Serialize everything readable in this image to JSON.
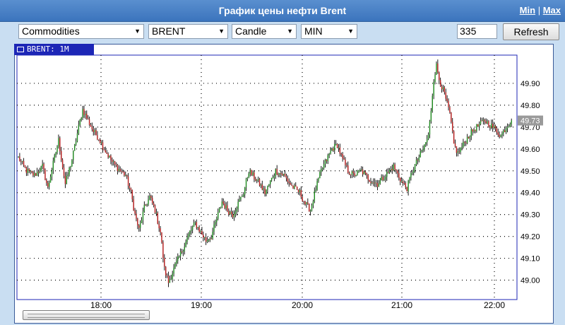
{
  "window": {
    "title": "График цены нефти Brent",
    "min_label": "Min",
    "separator": "|",
    "max_label": "Max"
  },
  "toolbar": {
    "category": "Commodities",
    "instrument": "BRENT",
    "chart_type": "Candle",
    "interval": "MIN",
    "bars": "335",
    "refresh_label": "Refresh"
  },
  "chart_tab_label": "BRENT: 1M",
  "colors": {
    "up": "#1e8a1e",
    "down": "#b51a1a",
    "wick": "#000000",
    "grid": "#000000",
    "frame": "#1c26b6",
    "price_badge": "#9a9a9a"
  },
  "chart_data": {
    "type": "candlestick",
    "symbol": "BRENT",
    "interval": "1M",
    "title": "",
    "xlabel": "",
    "ylabel": "",
    "ylim": [
      48.96,
      50.0
    ],
    "y_ticks": [
      "49.00",
      "49.10",
      "49.20",
      "49.30",
      "49.40",
      "49.50",
      "49.60",
      "49.70",
      "49.80",
      "49.90"
    ],
    "x_ticks": [
      "18:00",
      "19:00",
      "20:00",
      "21:00",
      "22:00"
    ],
    "last_price": "49.73",
    "grid": true,
    "anchors": [
      [
        0,
        49.56
      ],
      [
        6,
        49.5
      ],
      [
        12,
        49.48
      ],
      [
        18,
        49.52
      ],
      [
        22,
        49.42
      ],
      [
        24,
        49.48
      ],
      [
        30,
        49.64
      ],
      [
        35,
        49.44
      ],
      [
        40,
        49.55
      ],
      [
        45,
        49.7
      ],
      [
        48,
        49.78
      ],
      [
        52,
        49.73
      ],
      [
        56,
        49.68
      ],
      [
        60,
        49.65
      ],
      [
        64,
        49.6
      ],
      [
        70,
        49.54
      ],
      [
        76,
        49.5
      ],
      [
        80,
        49.48
      ],
      [
        84,
        49.4
      ],
      [
        87,
        49.3
      ],
      [
        90,
        49.23
      ],
      [
        94,
        49.33
      ],
      [
        98,
        49.38
      ],
      [
        102,
        49.32
      ],
      [
        106,
        49.22
      ],
      [
        109,
        49.05
      ],
      [
        112,
        48.99
      ],
      [
        118,
        49.08
      ],
      [
        124,
        49.16
      ],
      [
        128,
        49.22
      ],
      [
        132,
        49.26
      ],
      [
        136,
        49.22
      ],
      [
        140,
        49.18
      ],
      [
        144,
        49.2
      ],
      [
        148,
        49.28
      ],
      [
        152,
        49.36
      ],
      [
        156,
        49.32
      ],
      [
        160,
        49.3
      ],
      [
        164,
        49.35
      ],
      [
        168,
        49.4
      ],
      [
        172,
        49.5
      ],
      [
        176,
        49.47
      ],
      [
        180,
        49.44
      ],
      [
        184,
        49.4
      ],
      [
        188,
        49.45
      ],
      [
        192,
        49.5
      ],
      [
        198,
        49.48
      ],
      [
        204,
        49.43
      ],
      [
        210,
        49.4
      ],
      [
        214,
        49.35
      ],
      [
        218,
        49.32
      ],
      [
        222,
        49.42
      ],
      [
        226,
        49.5
      ],
      [
        230,
        49.55
      ],
      [
        234,
        49.6
      ],
      [
        238,
        49.62
      ],
      [
        242,
        49.55
      ],
      [
        246,
        49.5
      ],
      [
        250,
        49.48
      ],
      [
        256,
        49.5
      ],
      [
        262,
        49.46
      ],
      [
        268,
        49.44
      ],
      [
        274,
        49.48
      ],
      [
        280,
        49.52
      ],
      [
        286,
        49.45
      ],
      [
        290,
        49.42
      ],
      [
        294,
        49.5
      ],
      [
        298,
        49.55
      ],
      [
        302,
        49.6
      ],
      [
        306,
        49.66
      ],
      [
        308,
        49.78
      ],
      [
        310,
        49.92
      ],
      [
        312,
        49.98
      ],
      [
        314,
        49.92
      ],
      [
        318,
        49.85
      ],
      [
        322,
        49.76
      ],
      [
        325,
        49.62
      ],
      [
        328,
        49.58
      ],
      [
        332,
        49.62
      ],
      [
        336,
        49.66
      ],
      [
        340,
        49.69
      ],
      [
        344,
        49.71
      ],
      [
        348,
        49.73
      ],
      [
        352,
        49.71
      ],
      [
        356,
        49.69
      ],
      [
        360,
        49.66
      ],
      [
        364,
        49.7
      ],
      [
        368,
        49.73
      ]
    ]
  }
}
